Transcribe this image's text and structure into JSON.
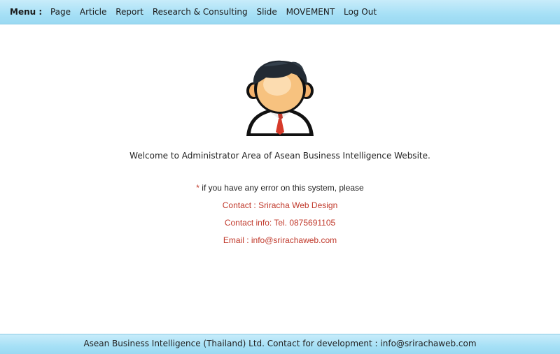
{
  "menu": {
    "label": "Menu :",
    "items": [
      "Page",
      "Article",
      "Report",
      "Research & Consulting",
      "Slide",
      "MOVEMENT",
      "Log Out"
    ]
  },
  "main": {
    "welcome": "Welcome to Administrator Area of Asean Business Intelligence Website.",
    "error_star": "*",
    "error_text": " if you have any error on this system, please",
    "contact": "Contact : Sriracha Web Design",
    "contact_info": "Contact info: Tel. 0875691105",
    "email": "Email : info@srirachaweb.com"
  },
  "footer": {
    "text": "Asean Business Intelligence (Thailand) Ltd. Contact for development : info@srirachaweb.com"
  },
  "colors": {
    "bar": "#a6e0f6",
    "accent_red": "#c0392b"
  },
  "icons": {
    "avatar": "user-avatar-icon"
  }
}
